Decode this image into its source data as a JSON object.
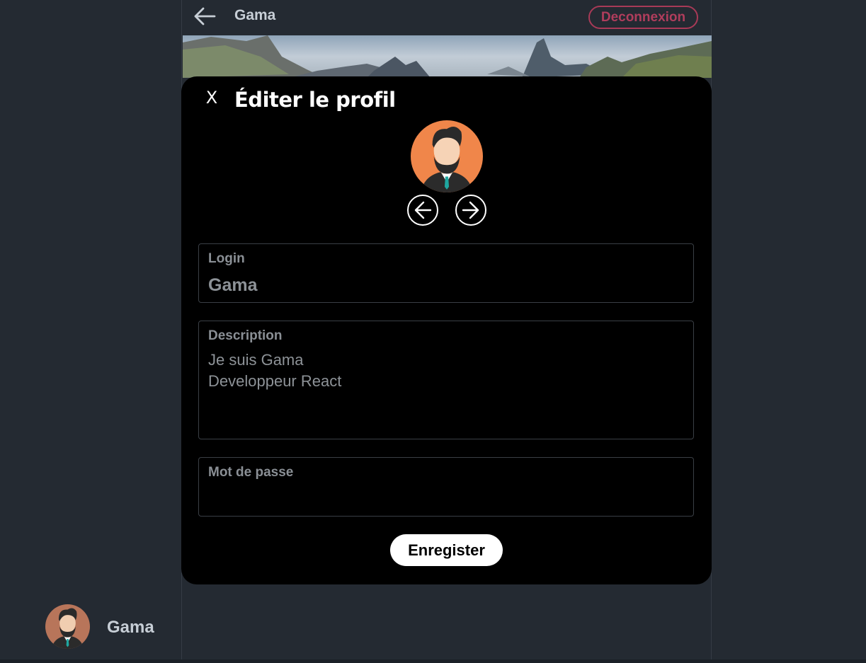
{
  "header": {
    "title": "Gama",
    "logout_label": "Deconnexion",
    "back_icon": "arrow-left-icon"
  },
  "modal": {
    "close_label": "X",
    "title": "Éditer le profil",
    "avatar_prev_icon": "arrow-circle-left-icon",
    "avatar_next_icon": "arrow-circle-right-icon",
    "fields": {
      "login": {
        "label": "Login",
        "value": "Gama"
      },
      "description": {
        "label": "Description",
        "lines": [
          "Je suis Gama",
          "Developpeur React"
        ]
      },
      "password": {
        "label": "Mot de passe",
        "value": ""
      }
    },
    "save_label": "Enregister"
  },
  "sidebar_user": {
    "name": "Gama"
  },
  "colors": {
    "background": "#242a32",
    "modal": "#000000",
    "logout_accent": "#b03d5c",
    "avatar_bg": "#f0864a",
    "text_muted": "#8d9297"
  }
}
